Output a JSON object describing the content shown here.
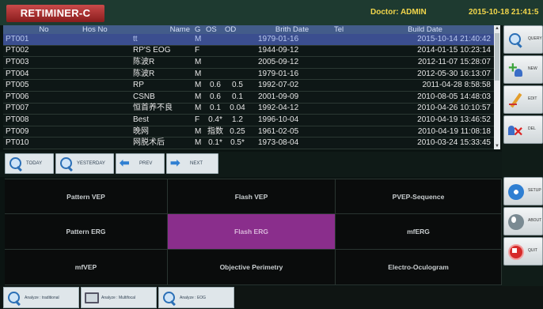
{
  "header": {
    "app_title": "RETIMINER-C",
    "doctor": "Doctor: ADMIN",
    "datetime": "2015-10-18 21:41:5"
  },
  "table": {
    "columns": [
      "No",
      "Hos No",
      "Name",
      "G",
      "OS",
      "OD",
      "Brith Date",
      "Tel",
      "Build Date"
    ],
    "rows": [
      {
        "no": "PT001",
        "hos": "",
        "name": "tt",
        "g": "M",
        "os": "",
        "od": "",
        "birth": "1979-01-16",
        "tel": "",
        "build": "2015-10-14 21:40:42",
        "selected": true
      },
      {
        "no": "PT002",
        "hos": "",
        "name": "RP'S EOG",
        "g": "F",
        "os": "",
        "od": "",
        "birth": "1944-09-12",
        "tel": "",
        "build": "2014-01-15 10:23:14"
      },
      {
        "no": "PT003",
        "hos": "",
        "name": "陈波R",
        "g": "M",
        "os": "",
        "od": "",
        "birth": "2005-09-12",
        "tel": "",
        "build": "2012-11-07 15:28:07"
      },
      {
        "no": "PT004",
        "hos": "",
        "name": "陈波R",
        "g": "M",
        "os": "",
        "od": "",
        "birth": "1979-01-16",
        "tel": "",
        "build": "2012-05-30 16:13:07"
      },
      {
        "no": "PT005",
        "hos": "",
        "name": "RP",
        "g": "M",
        "os": "0.6",
        "od": "0.5",
        "birth": "1992-07-02",
        "tel": "",
        "build": "2011-04-28 8:58:58"
      },
      {
        "no": "PT006",
        "hos": "",
        "name": "CSNB",
        "g": "M",
        "os": "0.6",
        "od": "0.1",
        "birth": "2001-09-09",
        "tel": "",
        "build": "2010-08-05 14:48:03"
      },
      {
        "no": "PT007",
        "hos": "",
        "name": "恒首养不良",
        "g": "M",
        "os": "0.1",
        "od": "0.04",
        "birth": "1992-04-12",
        "tel": "",
        "build": "2010-04-26 10:10:57"
      },
      {
        "no": "PT008",
        "hos": "",
        "name": "Best",
        "g": "F",
        "os": "0.4*",
        "od": "1.2",
        "birth": "1996-10-04",
        "tel": "",
        "build": "2010-04-19 13:46:52"
      },
      {
        "no": "PT009",
        "hos": "",
        "name": "晚网",
        "g": "M",
        "os": "指数",
        "od": "0.25",
        "birth": "1961-02-05",
        "tel": "",
        "build": "2010-04-19 11:08:18"
      },
      {
        "no": "PT010",
        "hos": "",
        "name": "网脱术后",
        "g": "M",
        "os": "0.1*",
        "od": "0.5*",
        "birth": "1973-08-04",
        "tel": "",
        "build": "2010-03-24 15:33:45"
      }
    ]
  },
  "nav": {
    "today": "TODAY",
    "yesterday": "YESTERDAY",
    "prev": "PREV",
    "next": "NEXT"
  },
  "tests": [
    "Pattern VEP",
    "Flash VEP",
    "PVEP-Sequence",
    "Pattern ERG",
    "Flash ERG",
    "mfERG",
    "mfVEP",
    "Objective Perimetry",
    "Electro-Oculogram"
  ],
  "active_test": "Flash ERG",
  "analyze": {
    "traditional": "Analyze : traditional",
    "multifocal": "Analyze : Multifocal",
    "eog": "Analyze : EOG"
  },
  "side": {
    "query": "QUERY",
    "new": "NEW",
    "edit": "EDIT",
    "del": "DEL",
    "setup": "SETUP",
    "about": "ABOUT",
    "quit": "QUIT"
  },
  "colors": {
    "header_bg": "#1e3a30",
    "brand_red": "#b23232",
    "doctor_text": "#f2d64b",
    "table_header": "#435c8a",
    "selected_row": "#3b4e8f",
    "active_test": "#8a2e8c"
  }
}
